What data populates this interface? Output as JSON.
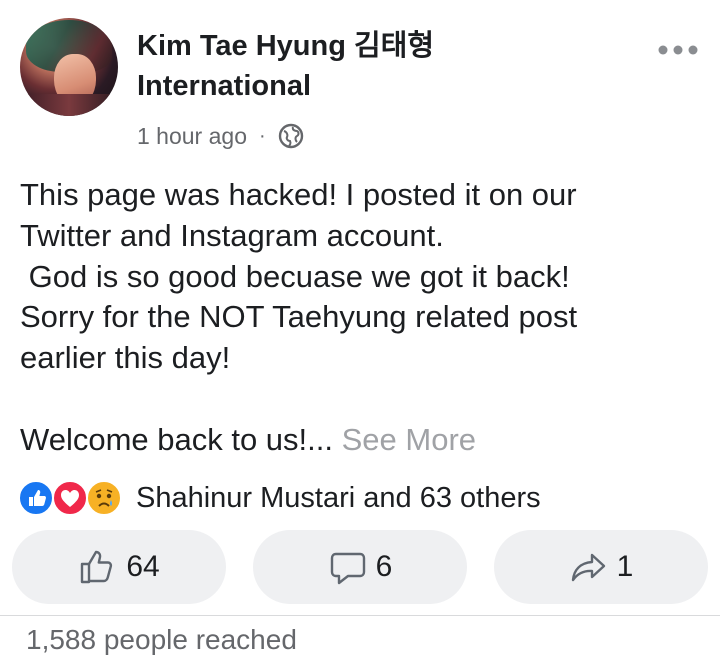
{
  "post": {
    "page_name_line1": "Kim Tae Hyung 김태형",
    "page_name_line2": "International",
    "time": "1 hour ago",
    "separator": "·",
    "privacy_icon": "globe-icon",
    "avatar_icon": "profile-photo",
    "more_icon": "more-horizontal-icon",
    "text_lines": [
      "This page was hacked! I posted it on our",
      "Twitter and Instagram account.",
      " God is so good becuase we got it back!",
      "Sorry for the NOT Taehyung related post",
      "earlier this day!",
      "",
      "Welcome back to us!..."
    ],
    "see_more": "See More"
  },
  "reactions": {
    "icons": [
      "like-reaction-icon",
      "love-reaction-icon",
      "sad-reaction-icon"
    ],
    "summary": "Shahinur Mustari and 63 others"
  },
  "actions": {
    "like_count": "64",
    "comment_count": "6",
    "share_count": "1"
  },
  "footer": {
    "reach": "1,588 people reached"
  },
  "colors": {
    "like_blue": "#1877f2",
    "love_red": "#f0284a",
    "sad_yellow": "#f7b125",
    "button_bg": "#eff0f2",
    "secondary_text": "#65676b"
  }
}
